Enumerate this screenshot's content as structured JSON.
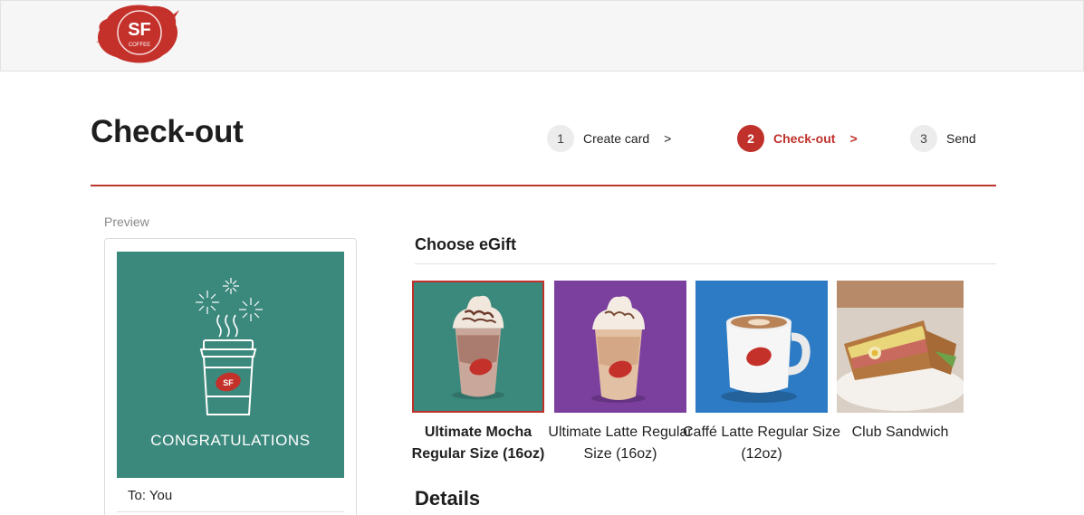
{
  "brand": {
    "logo_text": "SF",
    "logo_sub": "COFFEE",
    "accent": "#c0312b"
  },
  "page": {
    "title": "Check-out"
  },
  "steps": [
    {
      "num": "1",
      "label": "Create card",
      "arrow": ">",
      "active": false
    },
    {
      "num": "2",
      "label": "Check-out",
      "arrow": ">",
      "active": true
    },
    {
      "num": "3",
      "label": "Send",
      "arrow": "",
      "active": false
    }
  ],
  "preview": {
    "label": "Preview",
    "card_text": "CONGRATULATIONS",
    "to": "To: You",
    "card_color": "#3b887c"
  },
  "egift": {
    "title": "Choose eGift",
    "items": [
      {
        "name": "Ultimate Mocha Regular Size (16oz)",
        "selected": true,
        "bg": "#3b887c",
        "icon": "frappe-cup-icon"
      },
      {
        "name": "Ultimate Latte Regular Size (16oz)",
        "selected": false,
        "bg": "#7b3f9e",
        "icon": "frappe-cup-icon"
      },
      {
        "name": "Caffé Latte Regular Size (12oz)",
        "selected": false,
        "bg": "#2d7bc4",
        "icon": "coffee-mug-icon"
      },
      {
        "name": "Club Sandwich",
        "selected": false,
        "bg": "#d9cfc4",
        "icon": "sandwich-icon"
      }
    ]
  },
  "details": {
    "title": "Details"
  }
}
